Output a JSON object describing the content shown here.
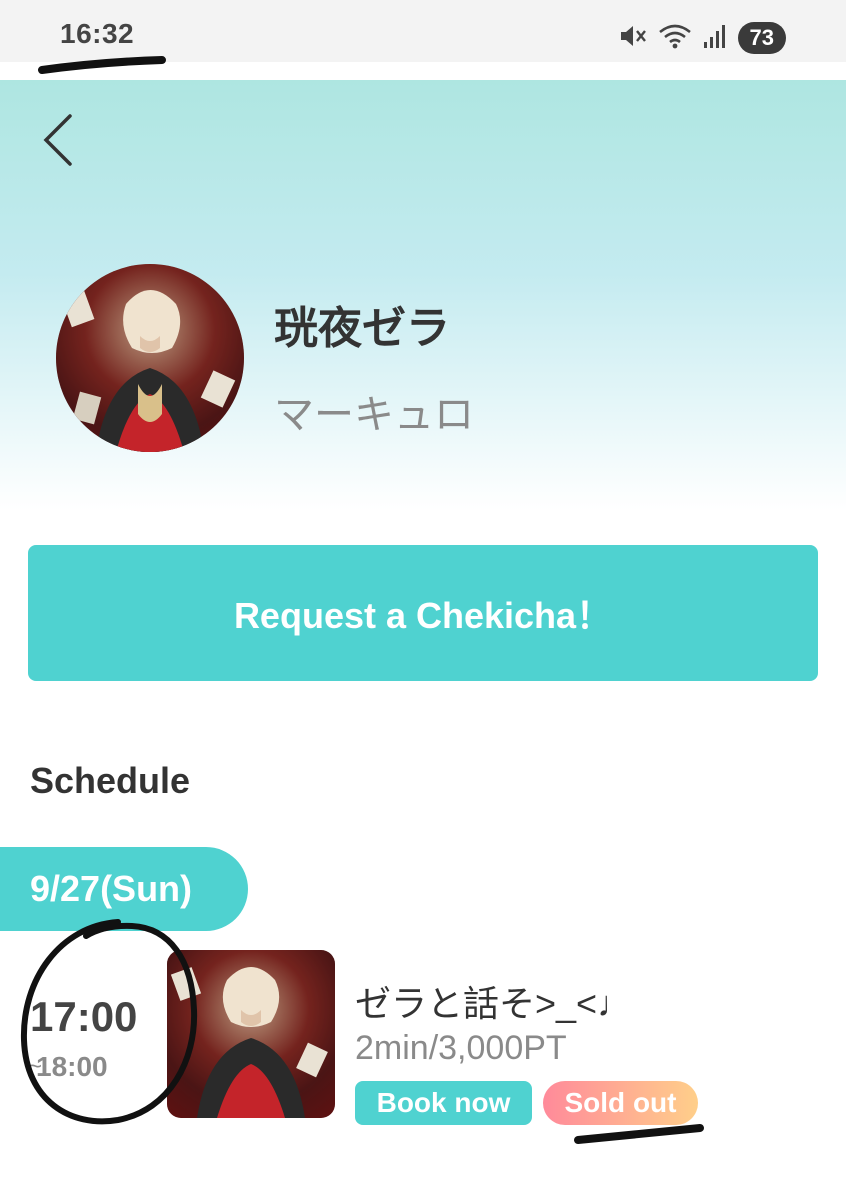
{
  "status_bar": {
    "time": "16:32",
    "battery": "73",
    "icons": [
      "mute-icon",
      "wifi-icon",
      "signal-icon"
    ]
  },
  "header": {
    "back_icon": "chevron-left-icon",
    "gradient_top": "#aee6e1",
    "gradient_bottom": "#ffffff"
  },
  "profile": {
    "name": "珖夜ゼラ",
    "group": "マーキュロ"
  },
  "request_button": {
    "label": "Request a Chekicha！",
    "color": "#4fd2d0"
  },
  "schedule": {
    "heading": "Schedule",
    "date": "9/27(Sun)",
    "slots": [
      {
        "start": "17:00",
        "end_tilde": "~",
        "end": "18:00",
        "title": "ゼラと話そ>_<♩",
        "price": "2min/3,000PT",
        "book_label": "Book now",
        "status_label": "Sold out"
      }
    ]
  },
  "colors": {
    "accent": "#4fd2d0",
    "sold_out_start": "#ff8a9a",
    "sold_out_end": "#ffcf8a"
  }
}
